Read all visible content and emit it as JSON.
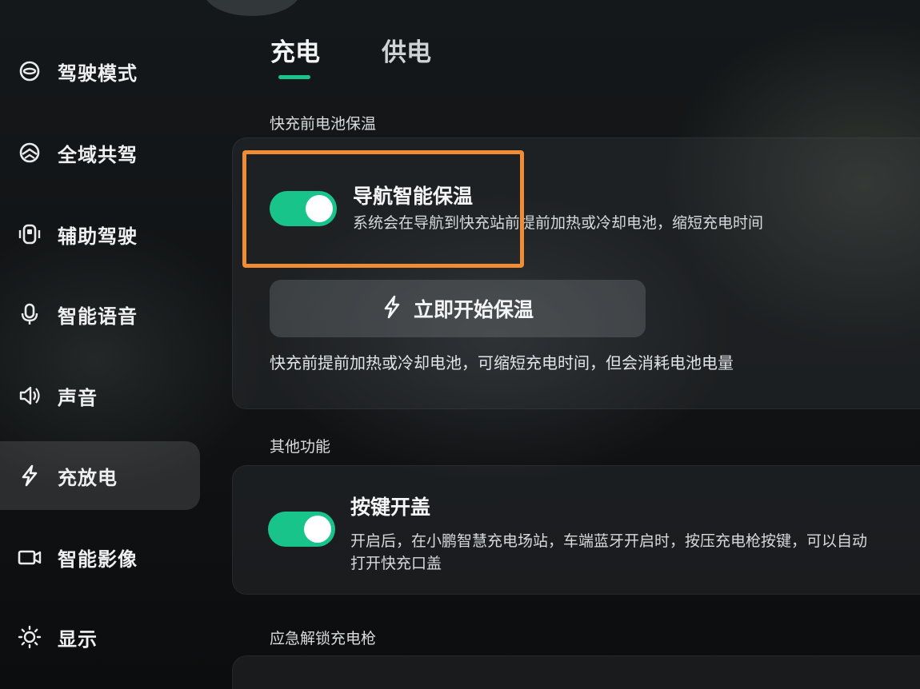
{
  "sidebar": {
    "items": [
      {
        "label": "驾驶模式",
        "icon": "steering-wheel-icon"
      },
      {
        "label": "全域共驾",
        "icon": "co-drive-icon"
      },
      {
        "label": "辅助驾驶",
        "icon": "assisted-driving-icon"
      },
      {
        "label": "智能语音",
        "icon": "microphone-icon"
      },
      {
        "label": "声音",
        "icon": "speaker-icon"
      },
      {
        "label": "充放电",
        "icon": "lightning-icon",
        "active": true
      },
      {
        "label": "智能影像",
        "icon": "camera-icon"
      },
      {
        "label": "显示",
        "icon": "sun-icon"
      }
    ]
  },
  "tabs": [
    {
      "label": "充电",
      "active": true
    },
    {
      "label": "供电",
      "active": false
    }
  ],
  "sections": {
    "preheat": {
      "title": "快充前电池保温",
      "nav_heat": {
        "title": "导航智能保温",
        "desc": "系统会在导航到快充站前提前加热或冷却电池，缩短充电时间",
        "enabled": true
      },
      "start_button": {
        "label": "立即开始保温",
        "icon": "lightning-icon"
      },
      "note": "快充前提前加热或冷却电池，可缩短充电时间，但会消耗电池电量"
    },
    "other": {
      "title": "其他功能",
      "button_open": {
        "title": "按键开盖",
        "desc_line1": "开启后，在小鹏智慧充电场站，车端蓝牙开启时，按压充电枪按键，可以自动",
        "desc_line2": "打开快充口盖",
        "enabled": true
      }
    },
    "emergency": {
      "title": "应急解锁充电枪"
    }
  },
  "colors": {
    "accent": "#19c48a",
    "highlight_box": "#f08d34"
  }
}
